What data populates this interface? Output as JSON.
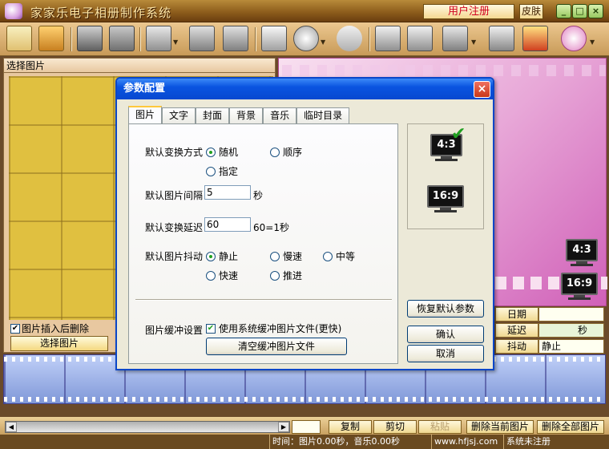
{
  "app": {
    "title": "家家乐电子相册制作系统",
    "register_label": "用户注册",
    "skin_label": "皮肤",
    "min": "_",
    "max": "□",
    "close": "×"
  },
  "left": {
    "header": "选择图片",
    "delete_after_insert": "图片插入后删除",
    "select_button": "选择图片"
  },
  "right": {
    "date_label": "日期",
    "delay_label": "延迟",
    "delay_unit": "秒",
    "shake_label": "抖动",
    "shake_value": "静止",
    "aspect_43": "4:3",
    "aspect_169": "16:9"
  },
  "bottom": {
    "copy": "复制",
    "cut": "剪切",
    "paste": "粘贴",
    "delete_current": "删除当前图片",
    "delete_all": "删除全部图片"
  },
  "status": {
    "time": "时间：图片0.00秒，音乐0.00秒",
    "site": "www.hfjsj.com",
    "reg": "系统未注册"
  },
  "dialog": {
    "title": "参数配置",
    "close": "×",
    "tabs": [
      "图片",
      "文字",
      "封面",
      "背景",
      "音乐",
      "临时目录"
    ],
    "active_tab": "图片",
    "transition_label": "默认变换方式",
    "transition_options": {
      "random": "随机",
      "order": "顺序",
      "specified": "指定"
    },
    "transition_selected": "随机",
    "interval_label": "默认图片间隔",
    "interval_value": "5",
    "interval_unit": "秒",
    "delay_label": "默认变换延迟",
    "delay_value": "60",
    "delay_unit": "60=1秒",
    "shake_label": "默认图片抖动",
    "shake_options": {
      "still": "静止",
      "slow": "慢速",
      "medium": "中等",
      "fast": "快速",
      "push": "推进"
    },
    "shake_selected": "静止",
    "buffer_label": "图片缓冲设置",
    "buffer_checkbox": "使用系统缓冲图片文件(更快)",
    "buffer_checked": true,
    "clear_buffer": "清空缓冲图片文件",
    "restore_defaults": "恢复默认参数",
    "ok": "确认",
    "cancel": "取消",
    "ratio_43": "4:3",
    "ratio_169": "16:9",
    "ratio_selected": "4:3"
  }
}
